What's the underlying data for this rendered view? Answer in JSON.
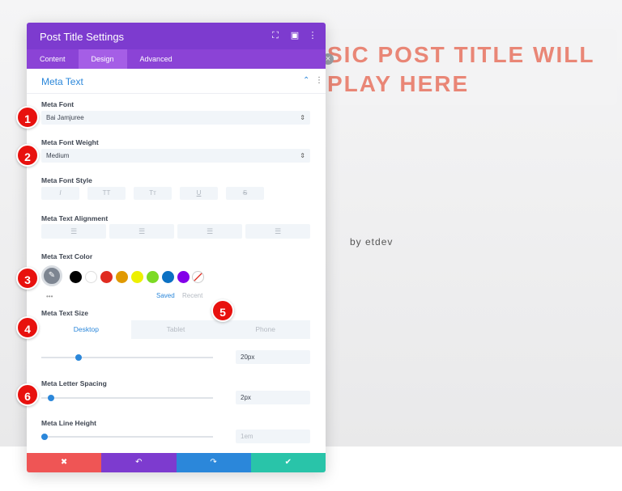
{
  "background": {
    "post_title": "SIC POST TITLE WILL\nPLAY HERE",
    "meta_by": "by etdev"
  },
  "panel": {
    "title": "Post Title Settings",
    "tabs": [
      "Content",
      "Design",
      "Advanced"
    ],
    "section_title": "Meta Text",
    "meta_font": {
      "label": "Meta Font",
      "value": "Bai Jamjuree"
    },
    "meta_font_weight": {
      "label": "Meta Font Weight",
      "value": "Medium"
    },
    "meta_font_style": {
      "label": "Meta Font Style",
      "buttons": [
        "I",
        "TT",
        "Tт",
        "U",
        "S"
      ]
    },
    "meta_text_alignment": {
      "label": "Meta Text Alignment"
    },
    "meta_text_color": {
      "label": "Meta Text Color",
      "swatches": [
        "#000000",
        "#ffffff",
        "#e02b20",
        "#e09900",
        "#edf000",
        "#7cda24",
        "#0c71c3",
        "#8300e9"
      ],
      "saved": "Saved",
      "recent": "Recent"
    },
    "meta_text_size": {
      "label": "Meta Text Size",
      "devices": [
        "Desktop",
        "Tablet",
        "Phone"
      ],
      "value": "20px",
      "slider_fraction": 0.2
    },
    "meta_letter_spacing": {
      "label": "Meta Letter Spacing",
      "value": "2px",
      "slider_fraction": 0.04
    },
    "meta_line_height": {
      "label": "Meta Line Height",
      "value": "1em",
      "slider_fraction": 0.0
    }
  },
  "badges": [
    "1",
    "2",
    "3",
    "4",
    "5",
    "6"
  ],
  "colors": {
    "header": "#7d3bcf",
    "accent": "#2b87da",
    "badge": "#e8110e",
    "footer": [
      "#ef5555",
      "#7d3bcf",
      "#2b87da",
      "#29c4a9"
    ]
  }
}
